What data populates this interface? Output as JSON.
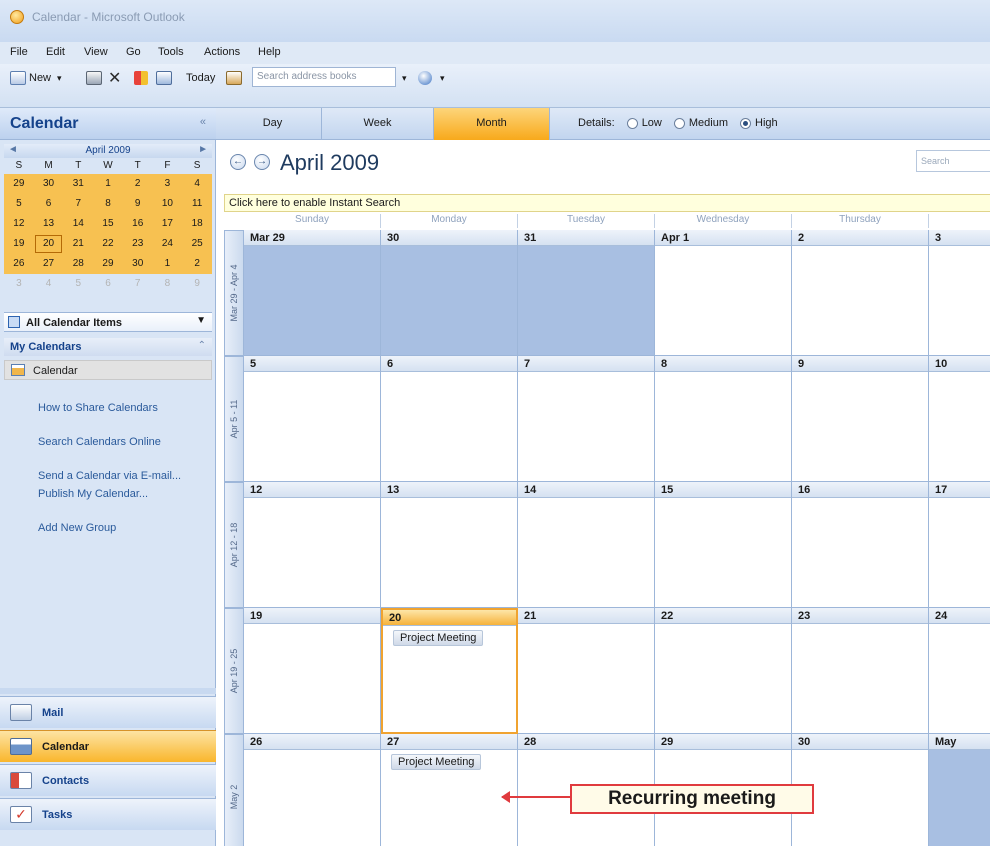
{
  "window": {
    "title": "Calendar - Microsoft Outlook"
  },
  "menu": [
    "File",
    "Edit",
    "View",
    "Go",
    "Tools",
    "Actions",
    "Help"
  ],
  "toolbar": {
    "new_label": "New",
    "today_label": "Today",
    "search_placeholder": "Search address books"
  },
  "nav": {
    "title": "Calendar",
    "collapse": "«",
    "mini_calendar": {
      "month": "April 2009",
      "prev": "◄",
      "next": "►",
      "dow": [
        "S",
        "M",
        "T",
        "W",
        "T",
        "F",
        "S"
      ],
      "weeks": [
        [
          "29",
          "30",
          "31",
          "1",
          "2",
          "3",
          "4"
        ],
        [
          "5",
          "6",
          "7",
          "8",
          "9",
          "10",
          "11"
        ],
        [
          "12",
          "13",
          "14",
          "15",
          "16",
          "17",
          "18"
        ],
        [
          "19",
          "20",
          "21",
          "22",
          "23",
          "24",
          "25"
        ],
        [
          "26",
          "27",
          "28",
          "29",
          "30",
          "1",
          "2"
        ],
        [
          "3",
          "4",
          "5",
          "6",
          "7",
          "8",
          "9"
        ]
      ],
      "today": "20"
    },
    "all_items": "All Calendar Items",
    "my_calendars": "My Calendars",
    "calendar_item": "Calendar",
    "links": [
      "How to Share Calendars",
      "Search Calendars Online",
      "Send a Calendar via E-mail...",
      "Publish My Calendar...",
      "Add New Group"
    ],
    "buttons": [
      "Mail",
      "Calendar",
      "Contacts",
      "Tasks"
    ]
  },
  "views": {
    "tabs": [
      "Day",
      "Week",
      "Month"
    ],
    "selected": "Month",
    "details_label": "Details:",
    "details_options": [
      "Low",
      "Medium",
      "High"
    ],
    "details_selected": "High"
  },
  "month_header": {
    "title": "April 2009",
    "prev": "←",
    "next": "→",
    "search": "Search"
  },
  "instant_search": "Click here to enable Instant Search",
  "calendar": {
    "dow": [
      "Sunday",
      "Monday",
      "Tuesday",
      "Wednesday",
      "Thursday",
      ""
    ],
    "weeks": [
      {
        "label": "Mar 29 - Apr 4",
        "days": [
          "Mar 29",
          "30",
          "31",
          "Apr 1",
          "2",
          "3"
        ]
      },
      {
        "label": "Apr 5 - 11",
        "days": [
          "5",
          "6",
          "7",
          "8",
          "9",
          "10"
        ]
      },
      {
        "label": "Apr 12 - 18",
        "days": [
          "12",
          "13",
          "14",
          "15",
          "16",
          "17"
        ]
      },
      {
        "label": "Apr 19 - 25",
        "days": [
          "19",
          "20",
          "21",
          "22",
          "23",
          "24"
        ]
      },
      {
        "label": "May 2",
        "days": [
          "26",
          "27",
          "28",
          "29",
          "30",
          "May"
        ]
      }
    ],
    "appointments": [
      {
        "week": 3,
        "day": 1,
        "title": "Project Meeting"
      },
      {
        "week": 4,
        "day": 1,
        "title": "Project Meeting"
      }
    ]
  },
  "annotation": {
    "text": "Recurring meeting"
  },
  "colors": {
    "accent": "#f8a91b",
    "header_blue": "#15428b",
    "other_month": "#a8bfe2",
    "callout_border": "#e03a3e"
  }
}
